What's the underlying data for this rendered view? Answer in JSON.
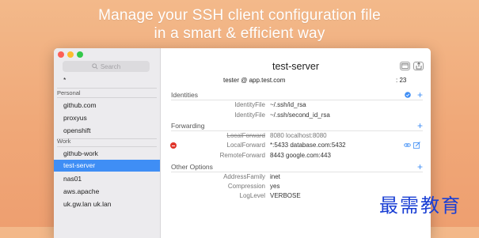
{
  "headline": {
    "line1": "Manage your SSH client configuration file",
    "line2": "in a smart & efficient way"
  },
  "sidebar": {
    "search_placeholder": "Search",
    "top_item": "*",
    "sections": [
      {
        "label": "Personal",
        "items": [
          "github.com",
          "proxyus",
          "openshift"
        ]
      },
      {
        "label": "Work",
        "items": [
          "github-work",
          "test-server",
          "nas01",
          "aws.apache",
          "uk.gw.lan uk.lan"
        ]
      }
    ],
    "selected": "test-server"
  },
  "host": {
    "title": "test-server",
    "connection": "tester @ app.test.com",
    "port": ": 23"
  },
  "sections": {
    "identities": {
      "title": "Identities",
      "rows": [
        {
          "key": "IdentityFile",
          "value": "~/.ssh/id_rsa"
        },
        {
          "key": "IdentityFile",
          "value": "~/.ssh/second_id_rsa"
        }
      ]
    },
    "forwarding": {
      "title": "Forwarding",
      "rows": [
        {
          "key": "LocalForward",
          "value": "8080 localhost:8080",
          "disabled": true
        },
        {
          "key": "LocalForward",
          "value": "*:5433 database.com:5432"
        },
        {
          "key": "RemoteForward",
          "value": "8443 google.com:443"
        }
      ]
    },
    "other": {
      "title": "Other Options",
      "rows": [
        {
          "key": "AddressFamily",
          "value": "inet"
        },
        {
          "key": "Compression",
          "value": "yes"
        },
        {
          "key": "LogLevel",
          "value": "VERBOSE"
        }
      ]
    }
  },
  "plus_glyph": "+",
  "watermark": "最需教育",
  "colors": {
    "accent": "#3f8ef5",
    "delete": "#e0352b",
    "background": "#f0a878"
  }
}
